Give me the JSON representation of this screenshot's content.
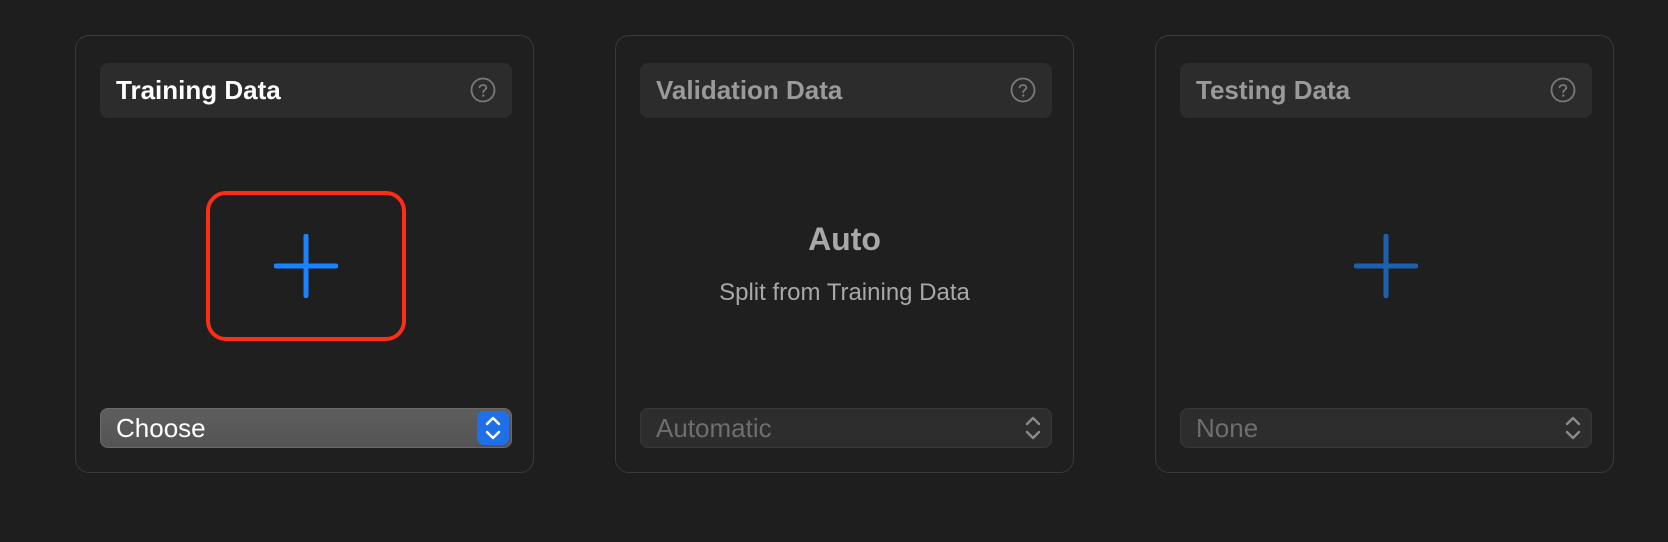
{
  "panels": [
    {
      "title": "Training Data",
      "active": true,
      "popup_value": "Choose",
      "highlighted": true
    },
    {
      "title": "Validation Data",
      "active": false,
      "center_title": "Auto",
      "center_subtitle": "Split from Training Data",
      "popup_value": "Automatic"
    },
    {
      "title": "Testing Data",
      "active": false,
      "popup_value": "None"
    }
  ],
  "colors": {
    "background": "#1e1e1e",
    "accent_blue": "#1a82ff",
    "dim_blue": "#1d5fb0",
    "highlight_red": "#ff2d16",
    "stepper_blue": "#1f6fe8"
  },
  "icons": {
    "help": "question-circle-icon",
    "add": "plus-icon",
    "stepper": "chevron-up-down-icon"
  }
}
